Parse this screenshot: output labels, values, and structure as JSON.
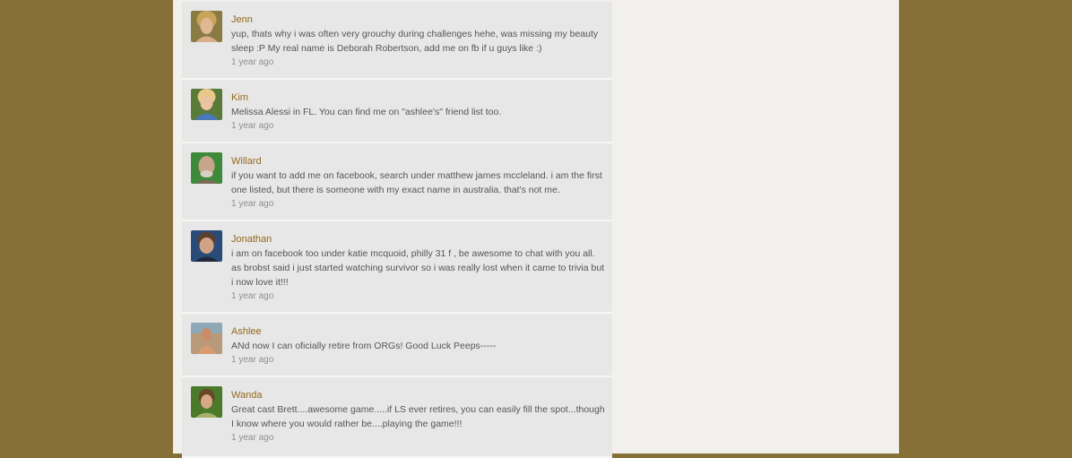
{
  "comments": [
    {
      "author": "Jenn",
      "avatar_icon": "jenn-avatar-photo",
      "text": "yup, thats why i was often very grouchy during challenges hehe, was missing my beauty sleep :P My real name is Deborah Robertson, add me on fb if u guys like :)",
      "time": "1 year ago"
    },
    {
      "author": "Kim",
      "avatar_icon": "kim-avatar-photo",
      "text": "Melissa Alessi in FL. You can find me on \"ashlee's\" friend list too.",
      "time": "1 year ago"
    },
    {
      "author": "Willard",
      "avatar_icon": "willard-avatar-photo",
      "text": "if you want to add me on facebook, search under matthew james mccleland. i am the first one listed, but there is someone with my exact name in australia. that's not me.",
      "time": "1 year ago"
    },
    {
      "author": "Jonathan",
      "avatar_icon": "jonathan-avatar-photo",
      "text": "i am on facebook too under katie mcquoid, philly 31 f , be awesome to chat with you all. as brobst said i just started watching survivor so i was really lost when it came to trivia but i now love it!!!",
      "time": "1 year ago"
    },
    {
      "author": "Ashlee",
      "avatar_icon": "ashlee-avatar-photo",
      "text": "ANd now I can oficially retire from ORGs!  Good Luck Peeps-----",
      "time": "1 year ago"
    },
    {
      "author": "Wanda",
      "avatar_icon": "wanda-avatar-photo",
      "text": "Great cast Brett....awesome game.....if LS ever retires, you can easily fill the spot...though I know where you would rather be....playing the game!!!",
      "time": "1 year ago"
    }
  ]
}
